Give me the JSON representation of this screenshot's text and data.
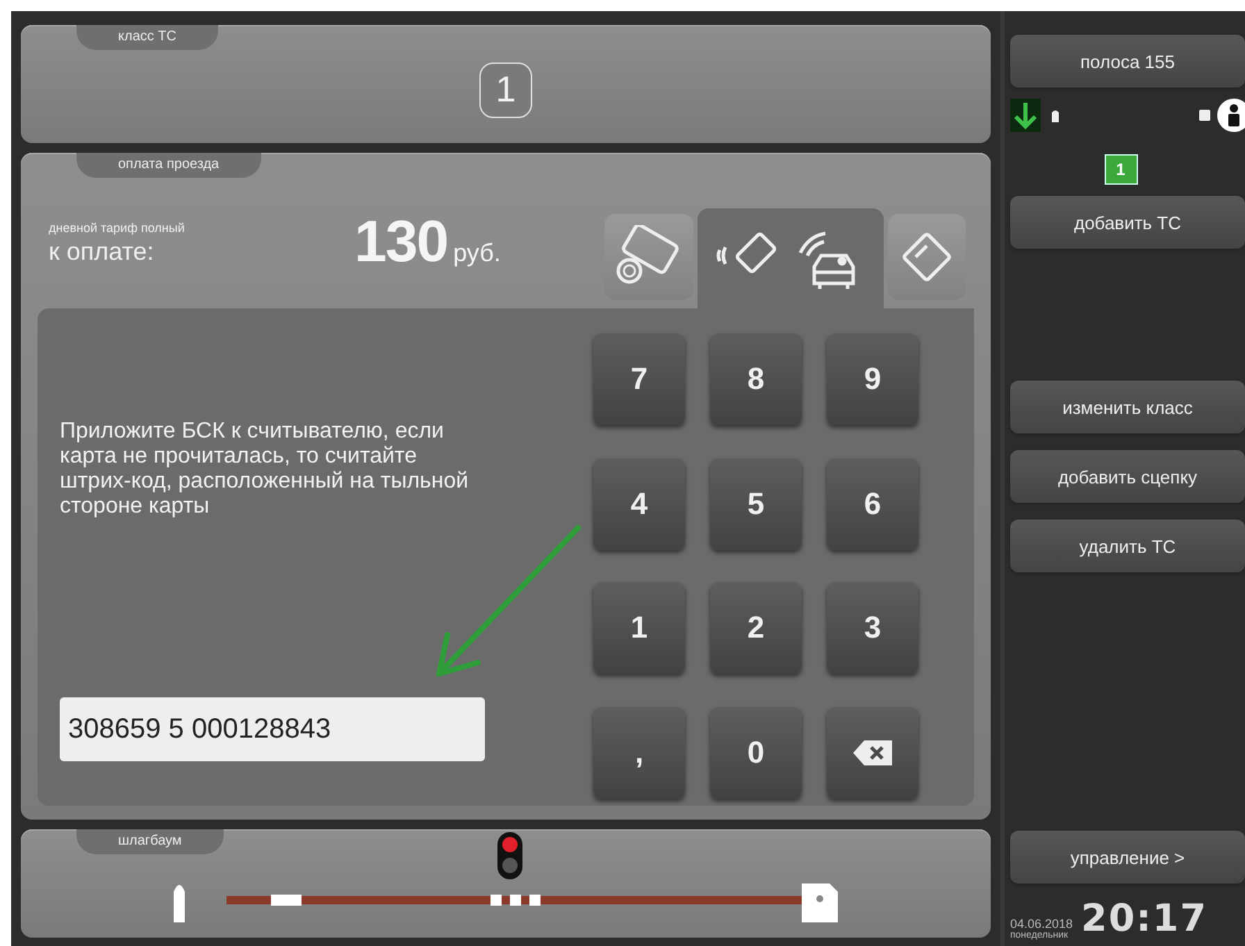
{
  "vehicle_class": {
    "label": "класс ТС",
    "value": "1"
  },
  "payment": {
    "label": "оплата проезда",
    "tariff": "дневной тариф полный",
    "due_label": "к оплате:",
    "amount": "130",
    "currency": "руб.",
    "methods": [
      {
        "kind": "cash",
        "selected": false
      },
      {
        "kind": "contactless",
        "selected": true
      },
      {
        "kind": "card",
        "selected": false
      }
    ],
    "instruction": "Приложите БСК к считывателю, если карта не прочиталась, то считайте штрих-код, расположенный на тыльной стороне карты",
    "card_number": {
      "value": "308659 5 000128843"
    },
    "keypad": [
      {
        "kind": "key",
        "label": "7"
      },
      {
        "kind": "key",
        "label": "8"
      },
      {
        "kind": "key",
        "label": "9"
      },
      {
        "kind": "key",
        "label": "4"
      },
      {
        "kind": "key",
        "label": "5"
      },
      {
        "kind": "key",
        "label": "6"
      },
      {
        "kind": "key",
        "label": "1"
      },
      {
        "kind": "key",
        "label": "2"
      },
      {
        "kind": "key",
        "label": "3"
      },
      {
        "kind": "key",
        "label": ","
      },
      {
        "kind": "key",
        "label": "0"
      },
      {
        "kind": "backspace"
      }
    ]
  },
  "barrier": {
    "label": "шлагбаум",
    "red_light_on": true
  },
  "lane": {
    "title": "полоса 155",
    "queue_count": "1"
  },
  "vehicle_buttons": [
    "добавить ТС"
  ],
  "edit_buttons": [
    "изменить класс",
    "добавить сцепку",
    "удалить ТС"
  ],
  "control_button": "управление >",
  "footer": {
    "date": "04.06.2018",
    "weekday": "понедельник",
    "time": "20:17"
  }
}
